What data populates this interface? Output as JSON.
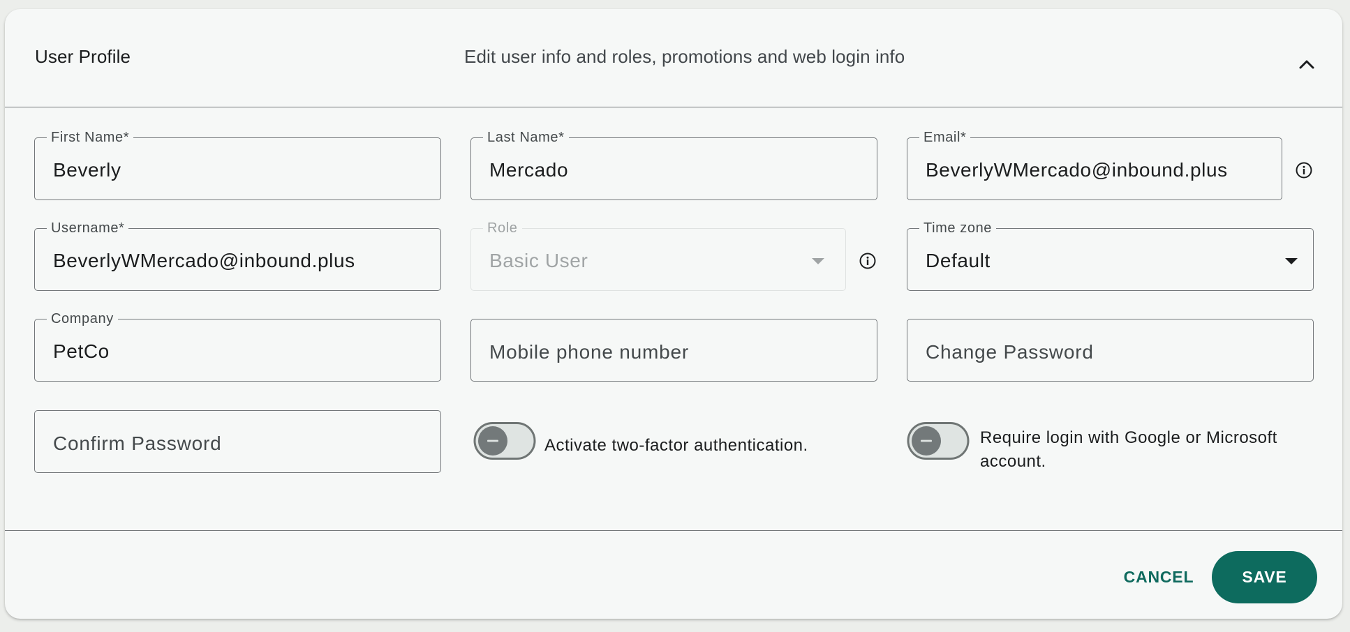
{
  "header": {
    "title": "User Profile",
    "subtitle": "Edit user info and roles, promotions and web login info"
  },
  "fields": {
    "first_name": {
      "label": "First Name*",
      "value": "Beverly"
    },
    "last_name": {
      "label": "Last Name*",
      "value": "Mercado"
    },
    "email": {
      "label": "Email*",
      "value": "BeverlyWMercado@inbound.plus"
    },
    "username": {
      "label": "Username*",
      "value": "BeverlyWMercado@inbound.plus"
    },
    "role": {
      "label": "Role",
      "value": "Basic User",
      "disabled": true
    },
    "time_zone": {
      "label": "Time zone",
      "value": "Default"
    },
    "company": {
      "label": "Company",
      "value": "PetCo"
    },
    "mobile_phone": {
      "placeholder": "Mobile phone number"
    },
    "change_password": {
      "placeholder": "Change Password"
    },
    "confirm_password": {
      "placeholder": "Confirm Password"
    }
  },
  "toggles": {
    "two_factor": {
      "label": "Activate two-factor authentication.",
      "checked": false
    },
    "require_sso": {
      "label": "Require login with Google or Microsoft account.",
      "checked": false
    }
  },
  "footer": {
    "cancel_label": "CANCEL",
    "save_label": "SAVE"
  },
  "colors": {
    "accent": "#0d6b5e",
    "card_background": "#f6f8f7",
    "page_background": "#eceeeb",
    "outline": "#73777a"
  },
  "icons": {
    "collapse": "chevron-up-icon",
    "info": "info-icon",
    "dropdown": "caret-down-icon",
    "toggle_off": "minus-icon"
  }
}
